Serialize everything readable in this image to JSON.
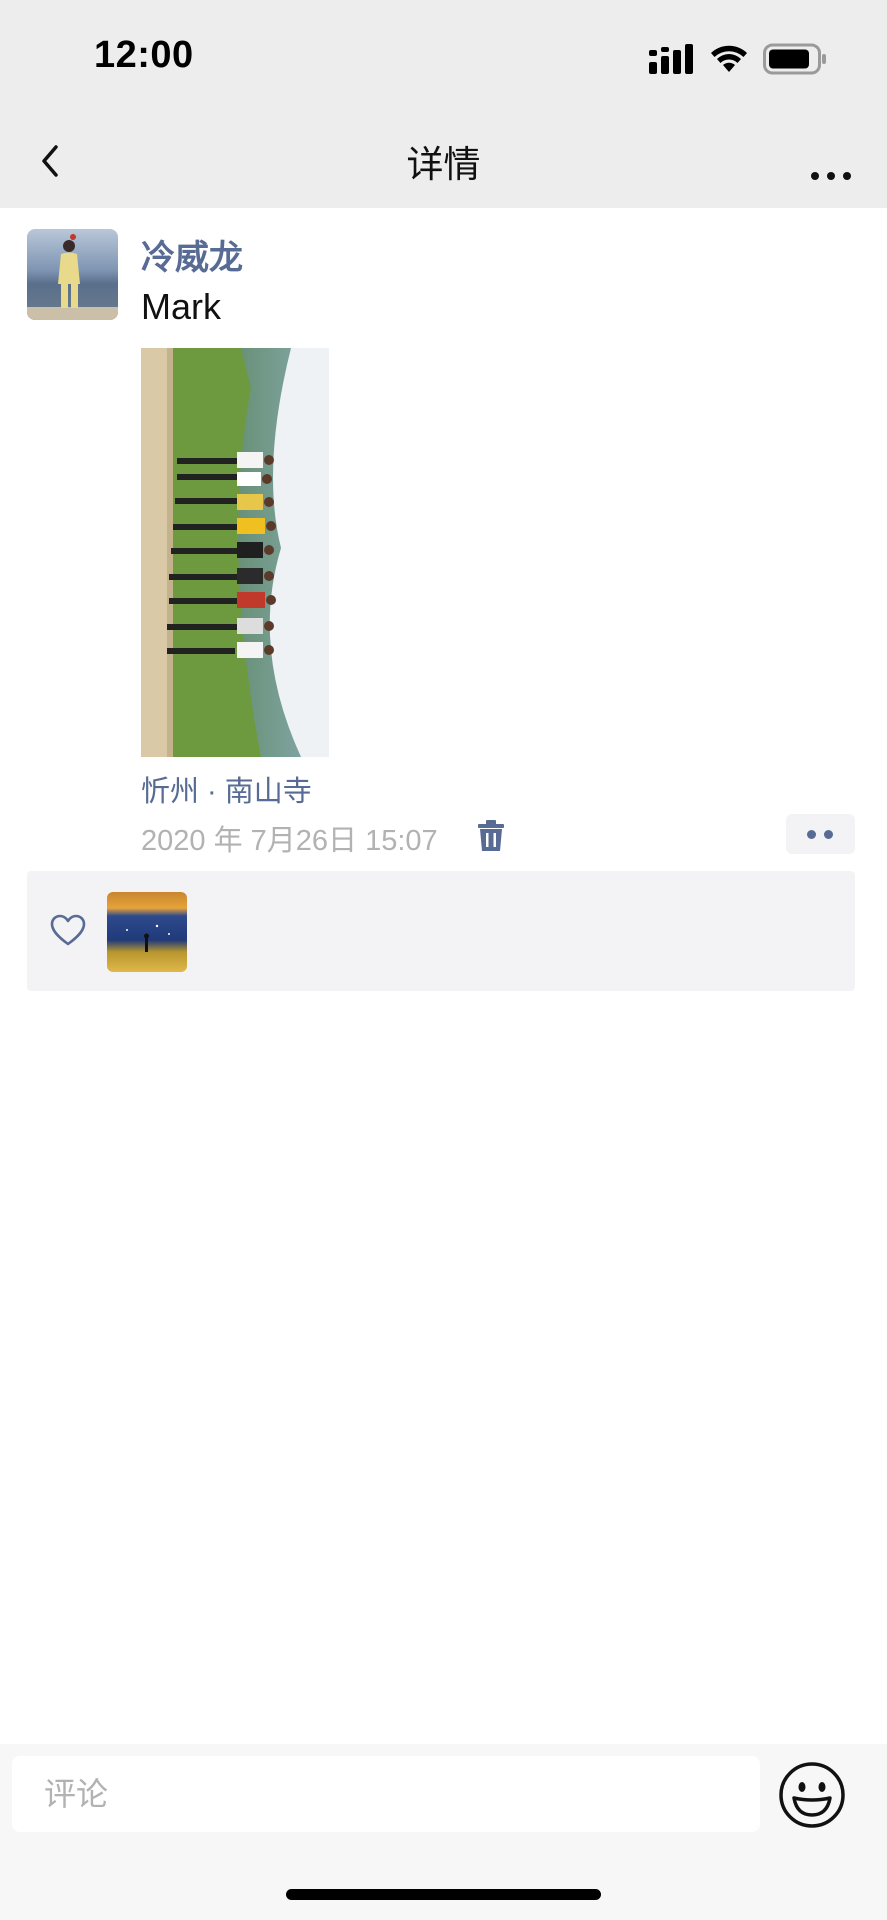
{
  "status_bar": {
    "time": "12:00"
  },
  "nav": {
    "title": "详情"
  },
  "post": {
    "author": "冷威龙",
    "text": "Mark",
    "location": "忻州 · 南山寺",
    "timestamp": "2020 年 7月26日 15:07"
  },
  "comment": {
    "placeholder": "评论"
  },
  "colors": {
    "link": "#576b95",
    "meta": "#b2b2b2",
    "bar_bg": "#ededed",
    "likes_bg": "#f3f3f5"
  },
  "icons": {
    "back": "chevron-left-icon",
    "more": "more-dots-icon",
    "delete": "trash-icon",
    "actions": "two-dots-icon",
    "like": "heart-icon",
    "emoji": "smiley-icon"
  }
}
